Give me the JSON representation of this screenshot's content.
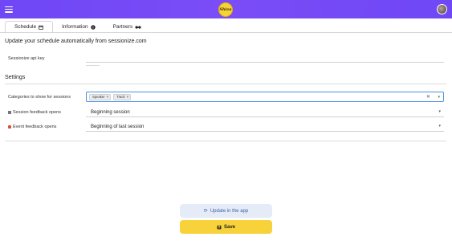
{
  "header": {
    "menu_icon": "hamburger-icon",
    "logo_text": "Shiza",
    "avatar": "user-avatar"
  },
  "tabs": [
    {
      "label": "Schedule",
      "icon": "calendar-icon",
      "active": true
    },
    {
      "label": "Information",
      "icon": "info-circle-icon",
      "active": false
    },
    {
      "label": "Partners",
      "icon": "handshake-icon",
      "active": false
    }
  ],
  "schedule": {
    "intro": "Update your schedule automatically from sessionize.com",
    "api_key_label": "Sessionize api key",
    "api_key_value": "______",
    "settings_title": "Settings",
    "categories_label": "Categories to show for sessions",
    "categories": [
      "Speaker",
      "Track"
    ],
    "session_feedback_label": "Session feedback opens",
    "session_feedback_icon": "square-icon",
    "session_feedback_value": "Beginning session",
    "event_feedback_label": "Event feedback opens",
    "event_feedback_icon": "flag-icon",
    "event_feedback_value": "Beginning of last session"
  },
  "buttons": {
    "update_label": "Update in the app",
    "save_label": "Save"
  },
  "colors": {
    "header": "#7a4df7",
    "save": "#f8d23a",
    "update_bg": "#e6ecf7",
    "focus_border": "#4a90e2"
  }
}
